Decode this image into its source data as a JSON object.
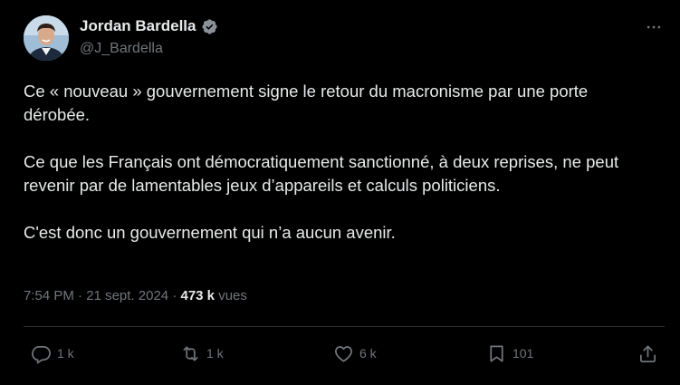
{
  "author": {
    "name": "Jordan Bardella",
    "handle": "@J_Bardella",
    "verified": true,
    "verified_color": "#8a9199"
  },
  "tweet": {
    "paragraphs": [
      "Ce « nouveau » gouvernement signe le retour du macronisme par une porte dérobée.",
      "Ce que les Français ont démocratiquement sanctionné, à deux reprises, ne peut revenir par de lamentables jeux d’appareils et calculs politiciens.",
      "C'est donc un gouvernement qui n’a aucun avenir."
    ],
    "time": "7:54 PM",
    "date": "21 sept. 2024",
    "separator": "·",
    "views_count": "473 k",
    "views_label": "vues"
  },
  "actions": {
    "replies": {
      "icon": "reply-icon",
      "count": "1 k"
    },
    "retweets": {
      "icon": "retweet-icon",
      "count": "1 k"
    },
    "likes": {
      "icon": "heart-icon",
      "count": "6 k"
    },
    "bookmarks": {
      "icon": "bookmark-icon",
      "count": "101"
    },
    "share": {
      "icon": "share-icon"
    }
  },
  "colors": {
    "background": "#000000",
    "text": "#e7e9ea",
    "secondary": "#71767b",
    "divider": "#2f3336"
  }
}
